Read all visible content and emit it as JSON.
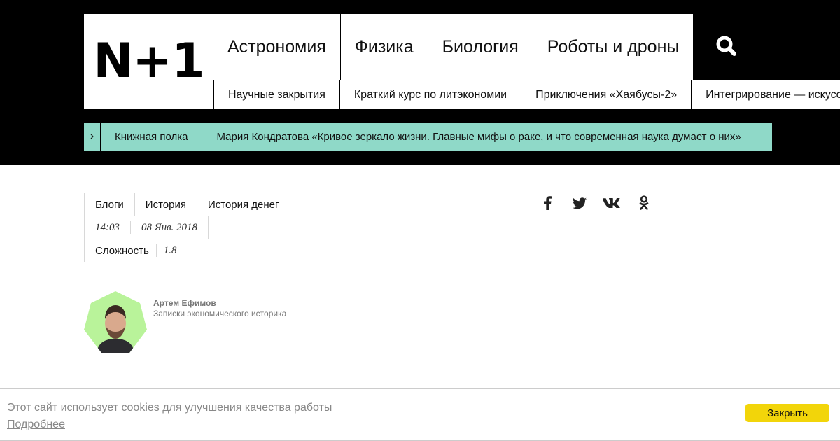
{
  "logo": {
    "text": "N+1"
  },
  "topnav": {
    "items": [
      "Астрономия",
      "Физика",
      "Биология",
      "Роботы и дроны"
    ]
  },
  "search": {
    "icon": "search-icon"
  },
  "subnav": {
    "items": [
      "Научные закрытия",
      "Краткий курс по литэкономии",
      "Приключения «Хаябусы-2»",
      "Интегрирование — искусство"
    ]
  },
  "ticker": {
    "arrow": "›",
    "category": "Книжная полка",
    "title": "Мария Кондратова «Кривое зеркало жизни. Главные мифы о раке, и что современная наука думает о них»",
    "color": "#8fd9c8"
  },
  "tags": [
    "Блоги",
    "История",
    "История денег"
  ],
  "meta": {
    "time": "14:03",
    "date": "08 Янв. 2018"
  },
  "difficulty": {
    "label": "Сложность",
    "value": "1.8"
  },
  "share": {
    "icons": [
      "facebook-icon",
      "twitter-icon",
      "vk-icon",
      "odnoklassniki-icon"
    ]
  },
  "author": {
    "name": "Артем Ефимов",
    "description": "Записки экономического историка",
    "avatar_bg": "#b9f39a"
  },
  "cookie": {
    "text": "Этот сайт использует cookies для улучшения качества работы",
    "more": "Подробнее",
    "close": "Закрыть",
    "button_color": "#f2d50a"
  }
}
